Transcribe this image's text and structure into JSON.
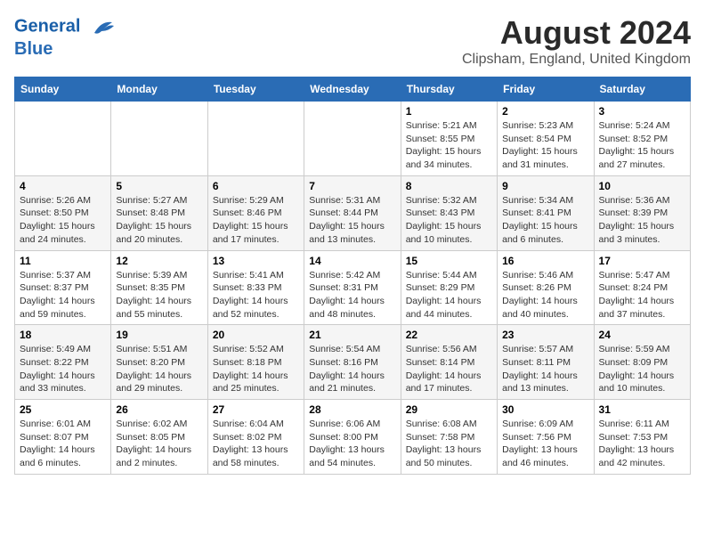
{
  "header": {
    "logo_line1": "General",
    "logo_line2": "Blue",
    "month_year": "August 2024",
    "location": "Clipsham, England, United Kingdom"
  },
  "weekdays": [
    "Sunday",
    "Monday",
    "Tuesday",
    "Wednesday",
    "Thursday",
    "Friday",
    "Saturday"
  ],
  "weeks": [
    [
      {
        "day": "",
        "info": ""
      },
      {
        "day": "",
        "info": ""
      },
      {
        "day": "",
        "info": ""
      },
      {
        "day": "",
        "info": ""
      },
      {
        "day": "1",
        "info": "Sunrise: 5:21 AM\nSunset: 8:55 PM\nDaylight: 15 hours\nand 34 minutes."
      },
      {
        "day": "2",
        "info": "Sunrise: 5:23 AM\nSunset: 8:54 PM\nDaylight: 15 hours\nand 31 minutes."
      },
      {
        "day": "3",
        "info": "Sunrise: 5:24 AM\nSunset: 8:52 PM\nDaylight: 15 hours\nand 27 minutes."
      }
    ],
    [
      {
        "day": "4",
        "info": "Sunrise: 5:26 AM\nSunset: 8:50 PM\nDaylight: 15 hours\nand 24 minutes."
      },
      {
        "day": "5",
        "info": "Sunrise: 5:27 AM\nSunset: 8:48 PM\nDaylight: 15 hours\nand 20 minutes."
      },
      {
        "day": "6",
        "info": "Sunrise: 5:29 AM\nSunset: 8:46 PM\nDaylight: 15 hours\nand 17 minutes."
      },
      {
        "day": "7",
        "info": "Sunrise: 5:31 AM\nSunset: 8:44 PM\nDaylight: 15 hours\nand 13 minutes."
      },
      {
        "day": "8",
        "info": "Sunrise: 5:32 AM\nSunset: 8:43 PM\nDaylight: 15 hours\nand 10 minutes."
      },
      {
        "day": "9",
        "info": "Sunrise: 5:34 AM\nSunset: 8:41 PM\nDaylight: 15 hours\nand 6 minutes."
      },
      {
        "day": "10",
        "info": "Sunrise: 5:36 AM\nSunset: 8:39 PM\nDaylight: 15 hours\nand 3 minutes."
      }
    ],
    [
      {
        "day": "11",
        "info": "Sunrise: 5:37 AM\nSunset: 8:37 PM\nDaylight: 14 hours\nand 59 minutes."
      },
      {
        "day": "12",
        "info": "Sunrise: 5:39 AM\nSunset: 8:35 PM\nDaylight: 14 hours\nand 55 minutes."
      },
      {
        "day": "13",
        "info": "Sunrise: 5:41 AM\nSunset: 8:33 PM\nDaylight: 14 hours\nand 52 minutes."
      },
      {
        "day": "14",
        "info": "Sunrise: 5:42 AM\nSunset: 8:31 PM\nDaylight: 14 hours\nand 48 minutes."
      },
      {
        "day": "15",
        "info": "Sunrise: 5:44 AM\nSunset: 8:29 PM\nDaylight: 14 hours\nand 44 minutes."
      },
      {
        "day": "16",
        "info": "Sunrise: 5:46 AM\nSunset: 8:26 PM\nDaylight: 14 hours\nand 40 minutes."
      },
      {
        "day": "17",
        "info": "Sunrise: 5:47 AM\nSunset: 8:24 PM\nDaylight: 14 hours\nand 37 minutes."
      }
    ],
    [
      {
        "day": "18",
        "info": "Sunrise: 5:49 AM\nSunset: 8:22 PM\nDaylight: 14 hours\nand 33 minutes."
      },
      {
        "day": "19",
        "info": "Sunrise: 5:51 AM\nSunset: 8:20 PM\nDaylight: 14 hours\nand 29 minutes."
      },
      {
        "day": "20",
        "info": "Sunrise: 5:52 AM\nSunset: 8:18 PM\nDaylight: 14 hours\nand 25 minutes."
      },
      {
        "day": "21",
        "info": "Sunrise: 5:54 AM\nSunset: 8:16 PM\nDaylight: 14 hours\nand 21 minutes."
      },
      {
        "day": "22",
        "info": "Sunrise: 5:56 AM\nSunset: 8:14 PM\nDaylight: 14 hours\nand 17 minutes."
      },
      {
        "day": "23",
        "info": "Sunrise: 5:57 AM\nSunset: 8:11 PM\nDaylight: 14 hours\nand 13 minutes."
      },
      {
        "day": "24",
        "info": "Sunrise: 5:59 AM\nSunset: 8:09 PM\nDaylight: 14 hours\nand 10 minutes."
      }
    ],
    [
      {
        "day": "25",
        "info": "Sunrise: 6:01 AM\nSunset: 8:07 PM\nDaylight: 14 hours\nand 6 minutes."
      },
      {
        "day": "26",
        "info": "Sunrise: 6:02 AM\nSunset: 8:05 PM\nDaylight: 14 hours\nand 2 minutes."
      },
      {
        "day": "27",
        "info": "Sunrise: 6:04 AM\nSunset: 8:02 PM\nDaylight: 13 hours\nand 58 minutes."
      },
      {
        "day": "28",
        "info": "Sunrise: 6:06 AM\nSunset: 8:00 PM\nDaylight: 13 hours\nand 54 minutes."
      },
      {
        "day": "29",
        "info": "Sunrise: 6:08 AM\nSunset: 7:58 PM\nDaylight: 13 hours\nand 50 minutes."
      },
      {
        "day": "30",
        "info": "Sunrise: 6:09 AM\nSunset: 7:56 PM\nDaylight: 13 hours\nand 46 minutes."
      },
      {
        "day": "31",
        "info": "Sunrise: 6:11 AM\nSunset: 7:53 PM\nDaylight: 13 hours\nand 42 minutes."
      }
    ]
  ]
}
